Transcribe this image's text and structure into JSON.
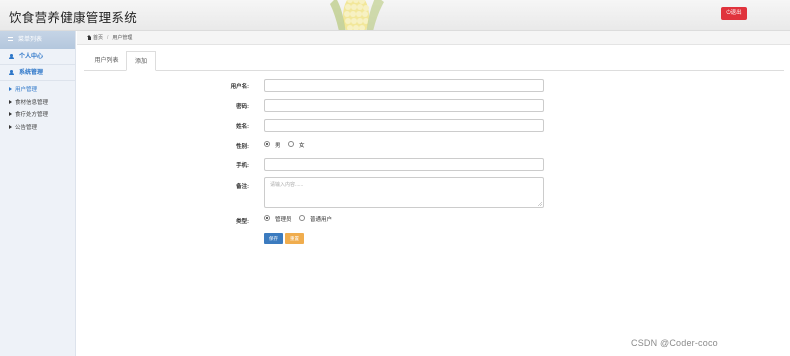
{
  "header": {
    "title": "饮食营养健康管理系统",
    "logout_label": "退出"
  },
  "sidebar": {
    "top_label": "菜单列表",
    "menus": [
      {
        "label": "个人中心"
      },
      {
        "label": "系统管理",
        "items": [
          {
            "label": "用户管理",
            "active": true
          },
          {
            "label": "食材信息管理"
          },
          {
            "label": "食疗处方管理"
          },
          {
            "label": "公告管理"
          }
        ]
      }
    ]
  },
  "breadcrumb": {
    "home": "首页",
    "current": "用户管理"
  },
  "tabs": [
    {
      "label": "用户列表"
    },
    {
      "label": "添加",
      "active": true
    }
  ],
  "form": {
    "username_label": "用户名:",
    "username_value": "",
    "password_label": "密码:",
    "password_value": "",
    "name_label": "姓名:",
    "name_value": "",
    "gender_label": "性别:",
    "gender_options": [
      "男",
      "女"
    ],
    "gender_selected": "男",
    "phone_label": "手机:",
    "phone_value": "",
    "remark_label": "备注:",
    "remark_placeholder": "请输入内容......",
    "type_label": "类型:",
    "type_options": [
      "管理员",
      "普通用户"
    ],
    "type_selected": "管理员",
    "save_label": "保存",
    "reset_label": "重置"
  },
  "watermark": "CSDN @Coder-coco",
  "colors": {
    "accent": "#2e77c9",
    "danger": "#e0333c",
    "primary_button": "#3b7bbf",
    "warning_button": "#f0ad4e"
  }
}
